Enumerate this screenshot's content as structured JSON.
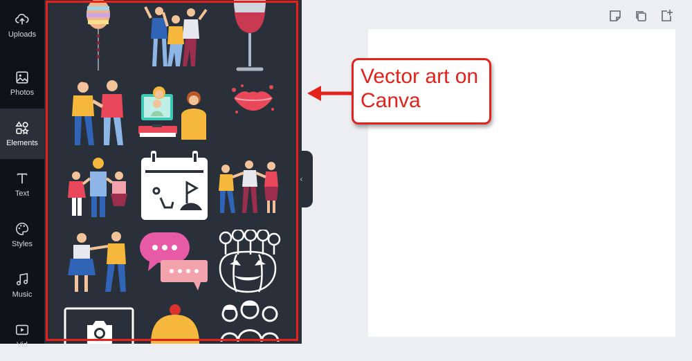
{
  "sidebar": {
    "items": [
      {
        "label": "Uploads",
        "icon": "upload-cloud-icon",
        "active": false
      },
      {
        "label": "Photos",
        "icon": "image-icon",
        "active": false
      },
      {
        "label": "Elements",
        "icon": "shapes-icon",
        "active": true
      },
      {
        "label": "Text",
        "icon": "text-icon",
        "active": false
      },
      {
        "label": "Styles",
        "icon": "palette-icon",
        "active": false
      },
      {
        "label": "Music",
        "icon": "music-note-icon",
        "active": false
      },
      {
        "label": "Vid",
        "icon": "video-icon",
        "active": false
      }
    ]
  },
  "elements_panel": {
    "tiles": [
      "balloon",
      "friends-cheering",
      "wine-glass",
      "two-friends",
      "video-call-people",
      "red-lips",
      "group-hug",
      "calendar-golf-icon",
      "dancing-group",
      "dancing-couple",
      "chat-bubbles",
      "halloween-pumpkin",
      "camera-frame",
      "cupcake",
      "people-line-art"
    ]
  },
  "page_toolbar": {
    "icons": [
      "note-icon",
      "duplicate-page-icon",
      "add-page-icon"
    ]
  },
  "annotation": {
    "text": "Vector art on Canva",
    "color": "#e3221c"
  },
  "colors": {
    "rail": "#0e1318",
    "panel": "#293039",
    "highlight": "#e8211d",
    "workspace": "#eceef1"
  }
}
